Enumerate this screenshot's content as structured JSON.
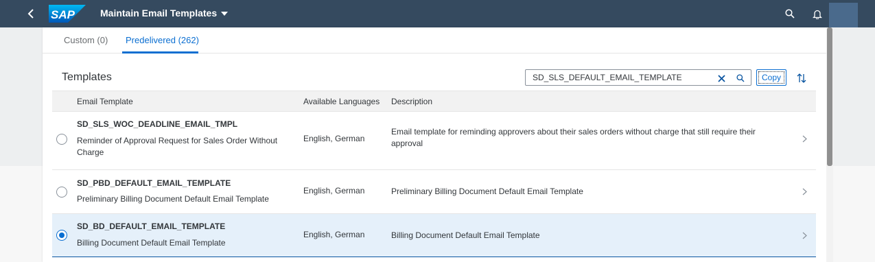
{
  "shell": {
    "logo_text": "SAP",
    "title": "Maintain Email Templates"
  },
  "tabs": [
    {
      "label": "Custom (0)"
    },
    {
      "label": "Predelivered (262)"
    }
  ],
  "toolbar": {
    "title": "Templates",
    "search_value": "SD_SLS_DEFAULT_EMAIL_TEMPLATE",
    "copy_label": "Copy"
  },
  "table": {
    "headers": [
      "Email Template",
      "Available Languages",
      "Description"
    ],
    "rows": [
      {
        "id": "SD_SLS_WOC_DEADLINE_EMAIL_TMPL",
        "name": "Reminder of Approval Request for Sales Order Without Charge",
        "languages": "English, German",
        "description": "Email template for reminding approvers about their sales orders without charge that still require their approval",
        "selected": false
      },
      {
        "id": "SD_PBD_DEFAULT_EMAIL_TEMPLATE",
        "name": "Preliminary Billing Document Default Email Template",
        "languages": "English, German",
        "description": "Preliminary Billing Document Default Email Template",
        "selected": false
      },
      {
        "id": "SD_BD_DEFAULT_EMAIL_TEMPLATE",
        "name": "Billing Document Default Email Template",
        "languages": "English, German",
        "description": "Billing Document Default Email Template",
        "selected": true
      }
    ]
  },
  "colors": {
    "shell": "#354a5f",
    "accent": "#0a6ed1",
    "selected_row": "#e5f0fa"
  }
}
